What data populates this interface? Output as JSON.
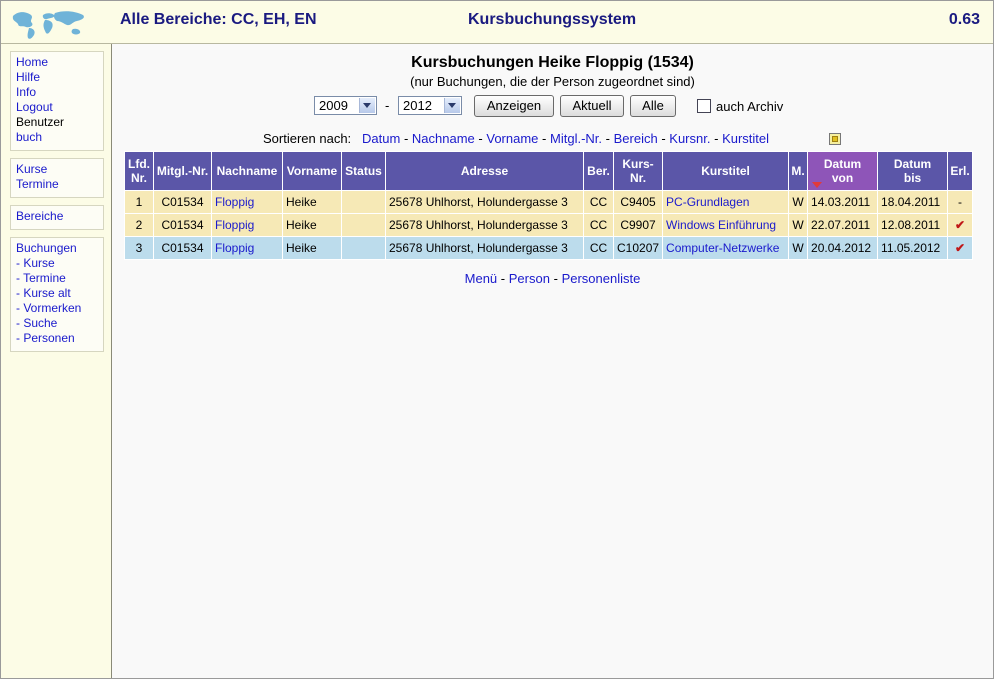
{
  "header": {
    "area": "Alle Bereiche: CC, EH, EN",
    "title": "Kursbuchungssystem",
    "version": "0.63"
  },
  "sidebar": {
    "group1": [
      {
        "label": "Home",
        "link": true
      },
      {
        "label": "Hilfe",
        "link": true
      },
      {
        "label": "Info",
        "link": true
      },
      {
        "label": "Logout",
        "link": true
      },
      {
        "label": "Benutzer",
        "link": false
      },
      {
        "label": "buch",
        "link": true
      }
    ],
    "group2": [
      {
        "label": "Kurse"
      },
      {
        "label": "Termine"
      }
    ],
    "group3": [
      {
        "label": "Bereiche"
      }
    ],
    "group4": [
      {
        "label": "Buchungen"
      },
      {
        "label": "- Kurse"
      },
      {
        "label": "- Termine"
      },
      {
        "label": "- Kurse alt"
      },
      {
        "label": "- Vormerken"
      },
      {
        "label": "- Suche"
      },
      {
        "label": "- Personen"
      }
    ]
  },
  "page": {
    "title": "Kursbuchungen Heike Floppig (1534)",
    "subtitle": "(nur Buchungen, die der Person zugeordnet sind)"
  },
  "filter": {
    "year_from": "2009",
    "dash": "-",
    "year_to": "2012",
    "btn_show": "Anzeigen",
    "btn_current": "Aktuell",
    "btn_all": "Alle",
    "archive_label": "auch Archiv",
    "archive_checked": false
  },
  "sort": {
    "prefix": "Sortieren nach:",
    "options": [
      "Datum",
      "Nachname",
      "Vorname",
      "Mitgl.-Nr.",
      "Bereich",
      "Kursnr.",
      "Kurstitel"
    ],
    "separator": "-"
  },
  "table": {
    "headers": [
      {
        "l1": "Lfd.",
        "l2": "Nr."
      },
      {
        "l1": "Mitgl.-Nr.",
        "l2": ""
      },
      {
        "l1": "Nachname",
        "l2": ""
      },
      {
        "l1": "Vorname",
        "l2": ""
      },
      {
        "l1": "Status",
        "l2": ""
      },
      {
        "l1": "Adresse",
        "l2": ""
      },
      {
        "l1": "Ber.",
        "l2": ""
      },
      {
        "l1": "Kurs-",
        "l2": "Nr."
      },
      {
        "l1": "Kurstitel",
        "l2": ""
      },
      {
        "l1": "M.",
        "l2": ""
      },
      {
        "l1": "Datum",
        "l2": "von"
      },
      {
        "l1": "Datum",
        "l2": "bis"
      },
      {
        "l1": "Erl.",
        "l2": ""
      }
    ],
    "rows": [
      {
        "nr": "1",
        "mitgl": "C01534",
        "nachname": "Floppig",
        "vorname": "Heike",
        "status": "",
        "adresse": "25678 Uhlhorst, Holundergasse 3",
        "ber": "CC",
        "kursnr": "C9405",
        "kurstitel": "PC-Grundlagen",
        "m": "W",
        "von": "14.03.2011",
        "bis": "18.04.2011",
        "erl": "-",
        "color": "y"
      },
      {
        "nr": "2",
        "mitgl": "C01534",
        "nachname": "Floppig",
        "vorname": "Heike",
        "status": "",
        "adresse": "25678 Uhlhorst, Holundergasse 3",
        "ber": "CC",
        "kursnr": "C9907",
        "kurstitel": "Windows Einführung",
        "m": "W",
        "von": "22.07.2011",
        "bis": "12.08.2011",
        "erl": "✔",
        "color": "y"
      },
      {
        "nr": "3",
        "mitgl": "C01534",
        "nachname": "Floppig",
        "vorname": "Heike",
        "status": "",
        "adresse": "25678 Uhlhorst, Holundergasse 3",
        "ber": "CC",
        "kursnr": "C10207",
        "kurstitel": "Computer-Netzwerke",
        "m": "W",
        "von": "20.04.2012",
        "bis": "11.05.2012",
        "erl": "✔",
        "color": "b"
      }
    ]
  },
  "footer": {
    "links": [
      "Menü",
      "Person",
      "Personenliste"
    ],
    "separator": "-"
  }
}
